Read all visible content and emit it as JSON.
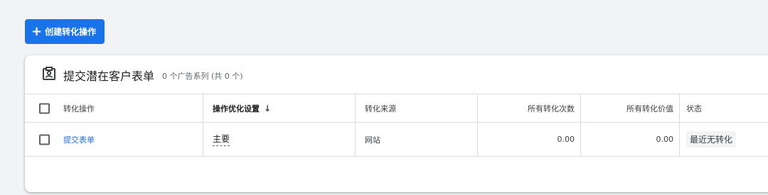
{
  "toolbar": {
    "create_label": "创建转化操作"
  },
  "card": {
    "title": "提交潜在客户表单",
    "subtitle": "0 个广告系列 (共 0 个)"
  },
  "table": {
    "headers": {
      "name": "转化操作",
      "optimization": "操作优化设置",
      "source": "转化来源",
      "all_conversions": "所有转化次数",
      "all_value": "所有转化价值",
      "status": "状态"
    },
    "rows": [
      {
        "name": "提交表单",
        "optimization": "主要",
        "source": "网站",
        "all_conversions": "0.00",
        "all_value": "0.00",
        "status": "最近无转化"
      }
    ]
  },
  "colors": {
    "accent": "#1a73e8",
    "background": "#f1f3f4"
  }
}
